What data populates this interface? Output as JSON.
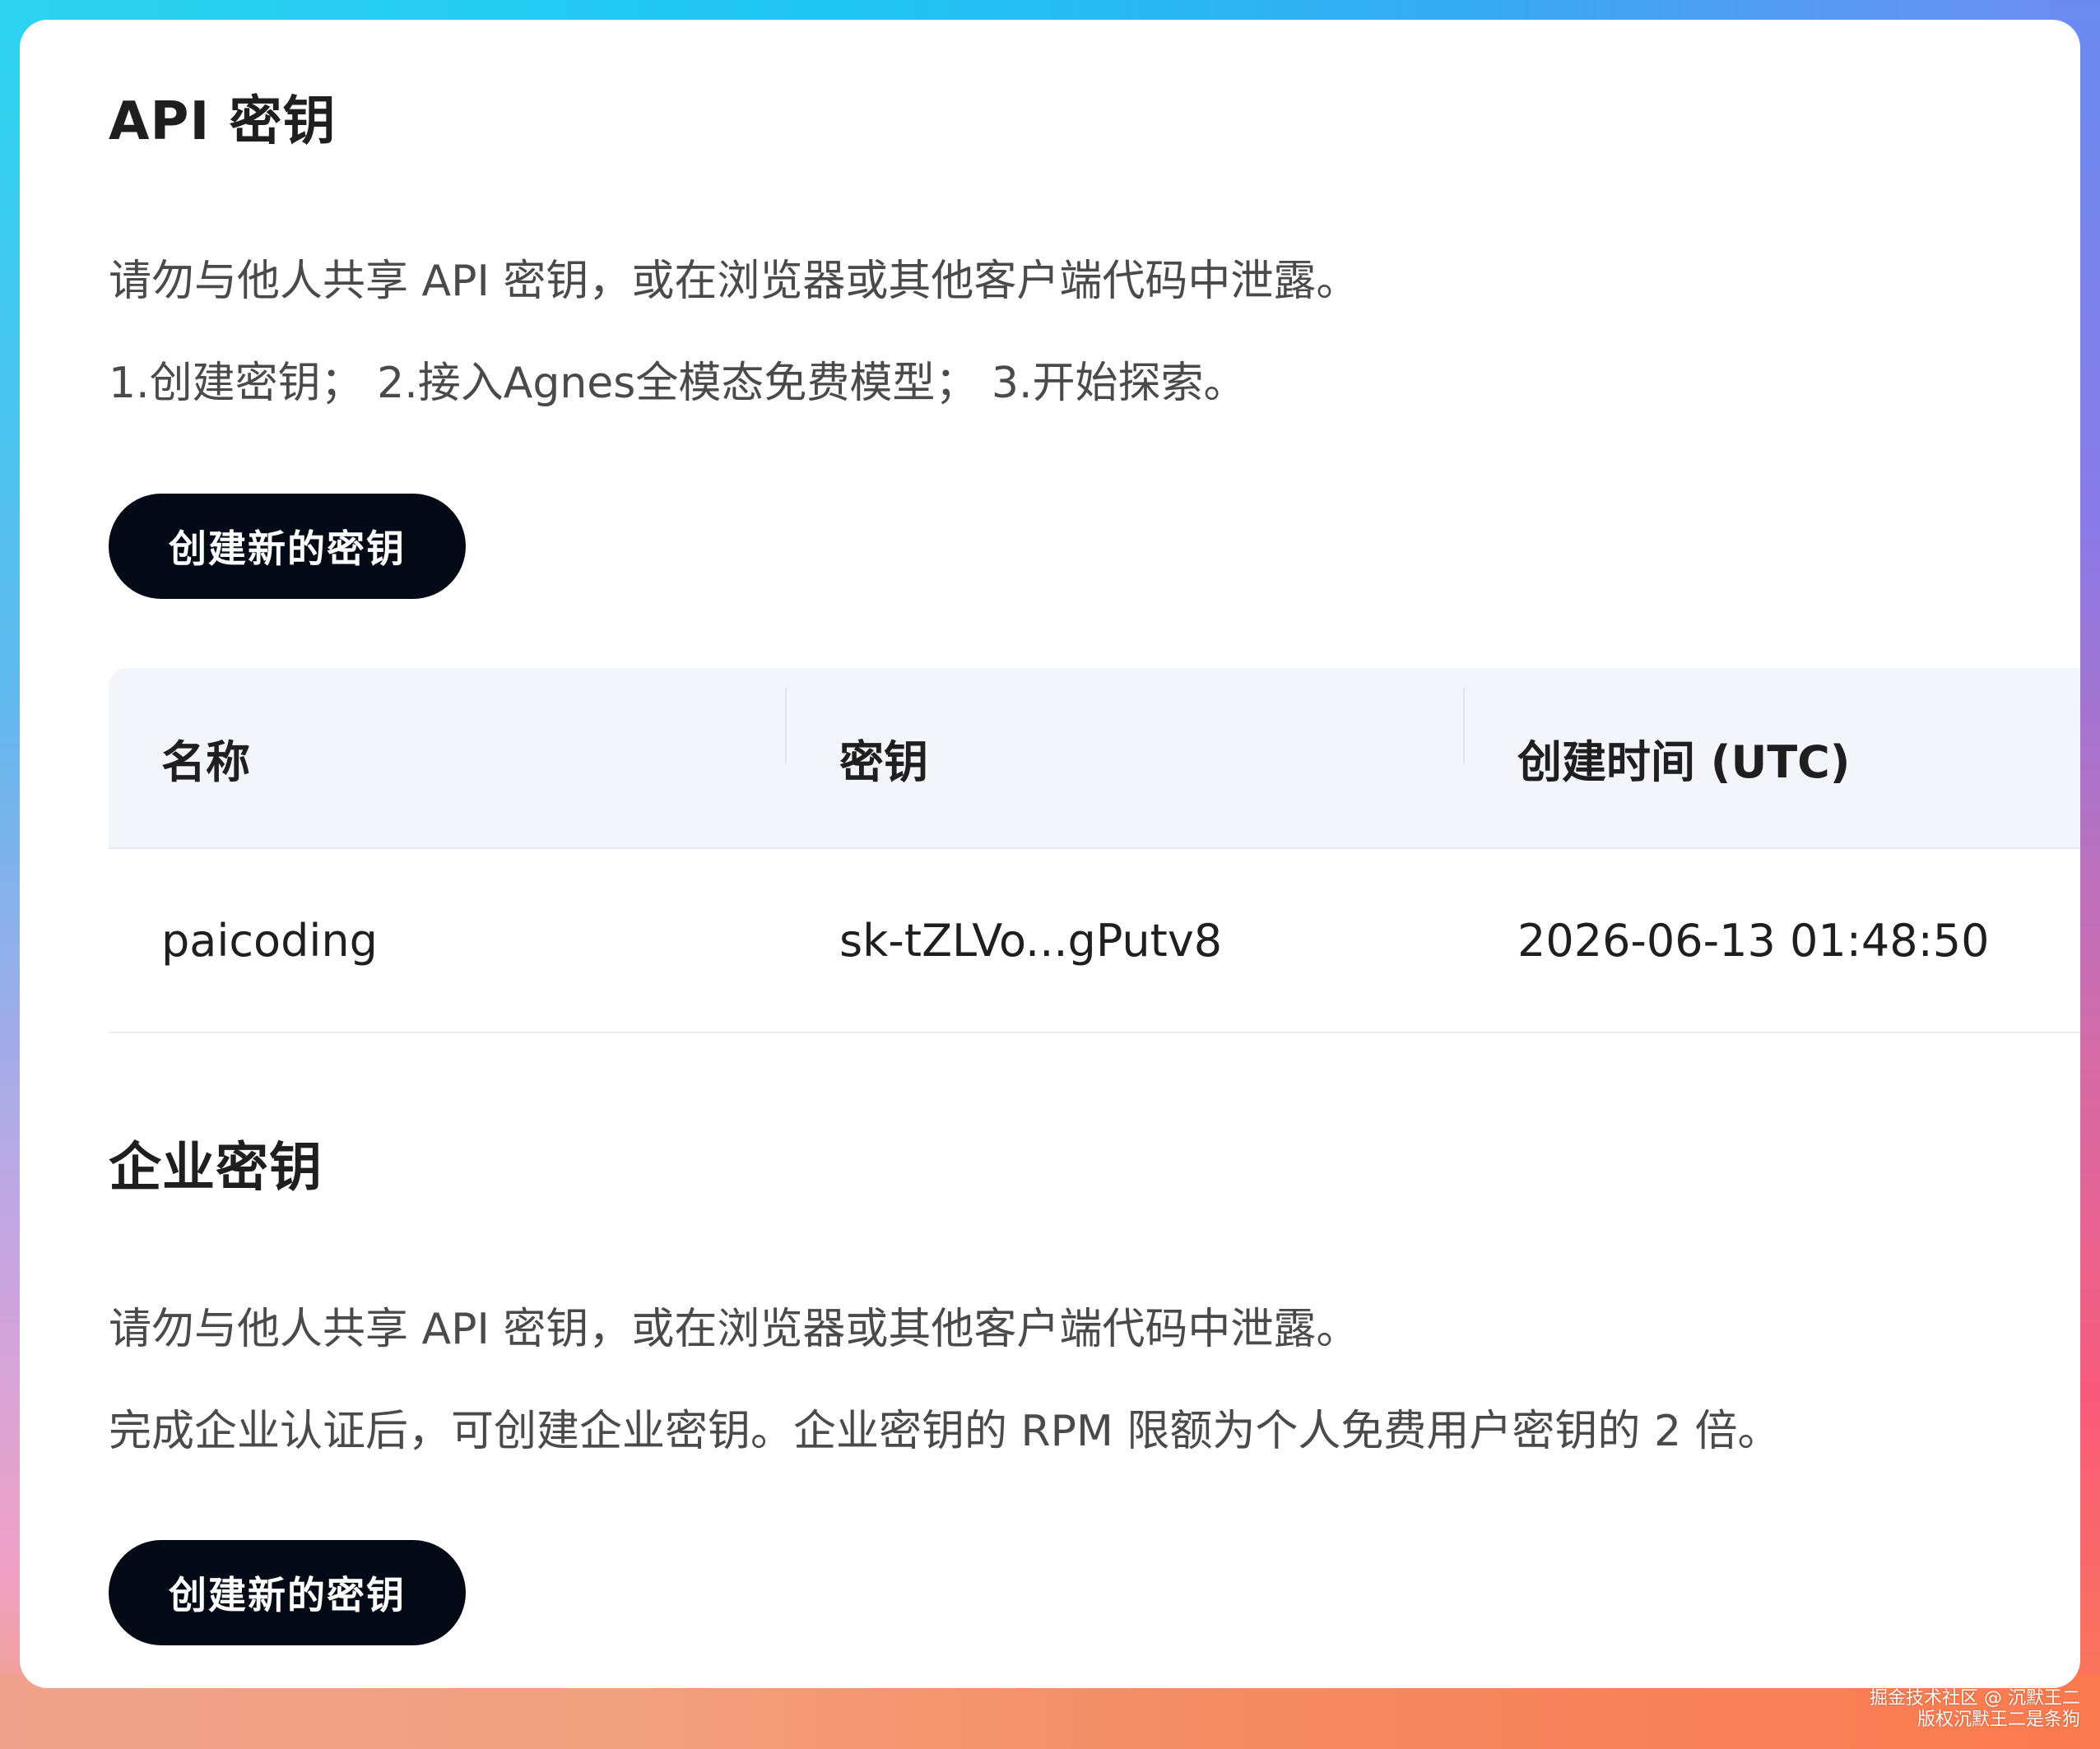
{
  "api_keys": {
    "title": "API 密钥",
    "desc_line1": "请勿与他人共享 API 密钥，或在浏览器或其他客户端代码中泄露。",
    "desc_line2": "1.创建密钥； 2.接入Agnes全模态免费模型； 3.开始探索。",
    "create_button": "创建新的密钥",
    "table": {
      "headers": [
        "名称",
        "密钥",
        "创建时间 (UTC)"
      ],
      "rows": [
        [
          "paicoding",
          "sk-tZLVo...gPutv8",
          "2026-06-13 01:48:50"
        ]
      ]
    }
  },
  "enterprise_keys": {
    "title": "企业密钥",
    "desc_line1": "请勿与他人共享 API 密钥，或在浏览器或其他客户端代码中泄露。",
    "desc_line2": "完成企业认证后，可创建企业密钥。企业密钥的 RPM 限额为个人免费用户密钥的 2 倍。",
    "create_button": "创建新的密钥"
  },
  "watermark": {
    "line1": "掘金技术社区 @ 沉默王二",
    "line2": "版权沉默王二是条狗"
  },
  "colors": {
    "button_bg": "#050a17",
    "table_header_bg": "#f4f5fb",
    "card_bg": "#ffffff"
  }
}
